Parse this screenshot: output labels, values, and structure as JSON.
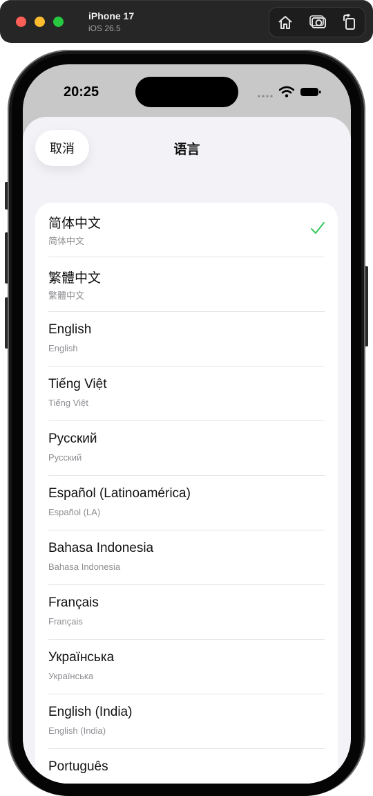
{
  "simulator": {
    "device_name": "iPhone 17",
    "os_version": "iOS 26.5",
    "toolbar_buttons": [
      "home-icon",
      "screenshot-icon",
      "rotate-icon"
    ]
  },
  "status_bar": {
    "time": "20:25"
  },
  "sheet": {
    "cancel_label": "取消",
    "title": "语言"
  },
  "languages": [
    {
      "name": "简体中文",
      "native": "简体中文",
      "selected": true
    },
    {
      "name": "繁體中文",
      "native": "繁體中文",
      "selected": false
    },
    {
      "name": "English",
      "native": "English",
      "selected": false
    },
    {
      "name": "Tiếng Việt",
      "native": "Tiếng Việt",
      "selected": false
    },
    {
      "name": "Русский",
      "native": "Русский",
      "selected": false
    },
    {
      "name": "Español (Latinoamérica)",
      "native": "Español (LA)",
      "selected": false
    },
    {
      "name": "Bahasa Indonesia",
      "native": "Bahasa Indonesia",
      "selected": false
    },
    {
      "name": "Français",
      "native": "Français",
      "selected": false
    },
    {
      "name": "Українська",
      "native": "Українська",
      "selected": false
    },
    {
      "name": "English (India)",
      "native": "English (India)",
      "selected": false
    },
    {
      "name": "Português",
      "native": "",
      "selected": false
    }
  ],
  "colors": {
    "accent_check": "#34c759",
    "sheet_background": "#f2f2f7"
  }
}
